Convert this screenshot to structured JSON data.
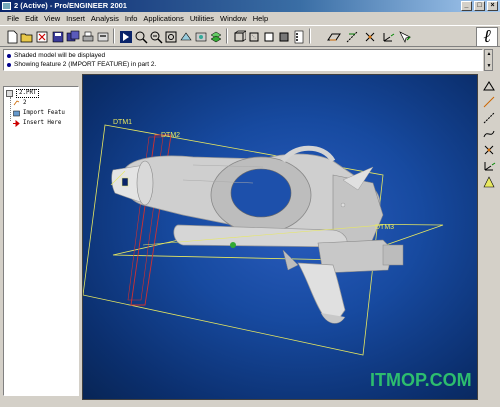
{
  "window": {
    "title": "2 (Active) - Pro/ENGINEER 2001"
  },
  "menu": [
    "File",
    "Edit",
    "View",
    "Insert",
    "Analysis",
    "Info",
    "Applications",
    "Utilities",
    "Window",
    "Help"
  ],
  "toolbar": {
    "icons": [
      "new-icon",
      "open-icon",
      "close-window-icon",
      "save-icon",
      "save-copy-icon",
      "print-icon",
      "email-icon",
      "repaint-icon",
      "zoom-in-icon",
      "zoom-out-icon",
      "refit-icon",
      "orient-icon",
      "saved-views-icon",
      "layers-icon",
      "wireframe-icon",
      "hidden-line-icon",
      "no-hidden-icon",
      "shading-icon",
      "model-tree-icon",
      "datum-planes-icon",
      "datum-axes-icon",
      "datum-points-icon",
      "coordinate-systems-icon",
      "context-help-icon"
    ]
  },
  "messages": [
    "Shaded model will be displayed",
    "Showing feature 2 (IMPORT FEATURE) in part 2."
  ],
  "model_tree": {
    "root": "2.PRT",
    "items": [
      {
        "label": "2",
        "icon": "datum-icon"
      },
      {
        "label": "Import Featu",
        "icon": "import-feature-icon"
      },
      {
        "label": "Insert Here",
        "icon": "insert-arrow-icon"
      }
    ]
  },
  "graphics": {
    "datum_labels": [
      "DTM1",
      "DTM2",
      "DTM3"
    ],
    "background_color": "#174aa0"
  },
  "right_toolbar": {
    "icons": [
      "sketch-icon",
      "datum-plane-tool-icon",
      "datum-axis-tool-icon",
      "datum-curve-tool-icon",
      "datum-point-tool-icon",
      "csys-tool-icon",
      "analysis-tool-icon"
    ]
  },
  "watermark": "ITMOP.COM"
}
